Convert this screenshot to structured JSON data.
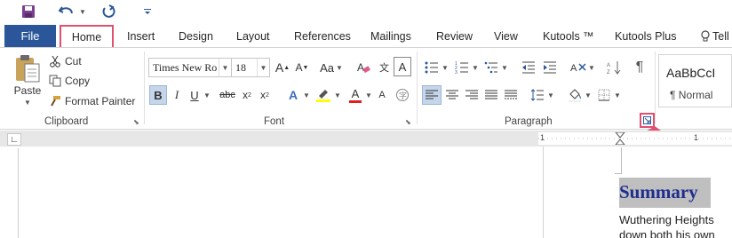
{
  "tabs": {
    "file": "File",
    "items": [
      "Home",
      "Insert",
      "Design",
      "Layout",
      "References",
      "Mailings",
      "Review",
      "View",
      "Kutools ™",
      "Kutools Plus",
      "Tell"
    ]
  },
  "clipboard": {
    "paste": "Paste",
    "cut": "Cut",
    "copy": "Copy",
    "format_painter": "Format Painter",
    "label": "Clipboard"
  },
  "font": {
    "font_name": "Times New Ro",
    "font_size": "18",
    "label": "Font",
    "grow": "A",
    "shrink": "A",
    "change_case": "Aa",
    "bold": "B",
    "italic": "I",
    "underline": "U",
    "strike": "abc",
    "subscript": "x",
    "superscript": "x",
    "sub_mark": "2",
    "sup_mark": "2",
    "text_effects": "A",
    "font_color": "A",
    "enclosed": "字"
  },
  "paragraph": {
    "label": "Paragraph",
    "pilcrow": "¶"
  },
  "styles": {
    "sample": "AaBbCcI",
    "normal": "¶ Normal"
  },
  "ruler": {
    "left_mark": "1",
    "right_mark": "1"
  },
  "document": {
    "heading": "Summary",
    "line1": "Wuthering Heights",
    "line2": "down both his own"
  },
  "colors": {
    "file_tab": "#2b579a",
    "highlight_box": "#e0506f",
    "heading_text": "#1f2e8f",
    "heading_bg": "#bfbfbf"
  }
}
